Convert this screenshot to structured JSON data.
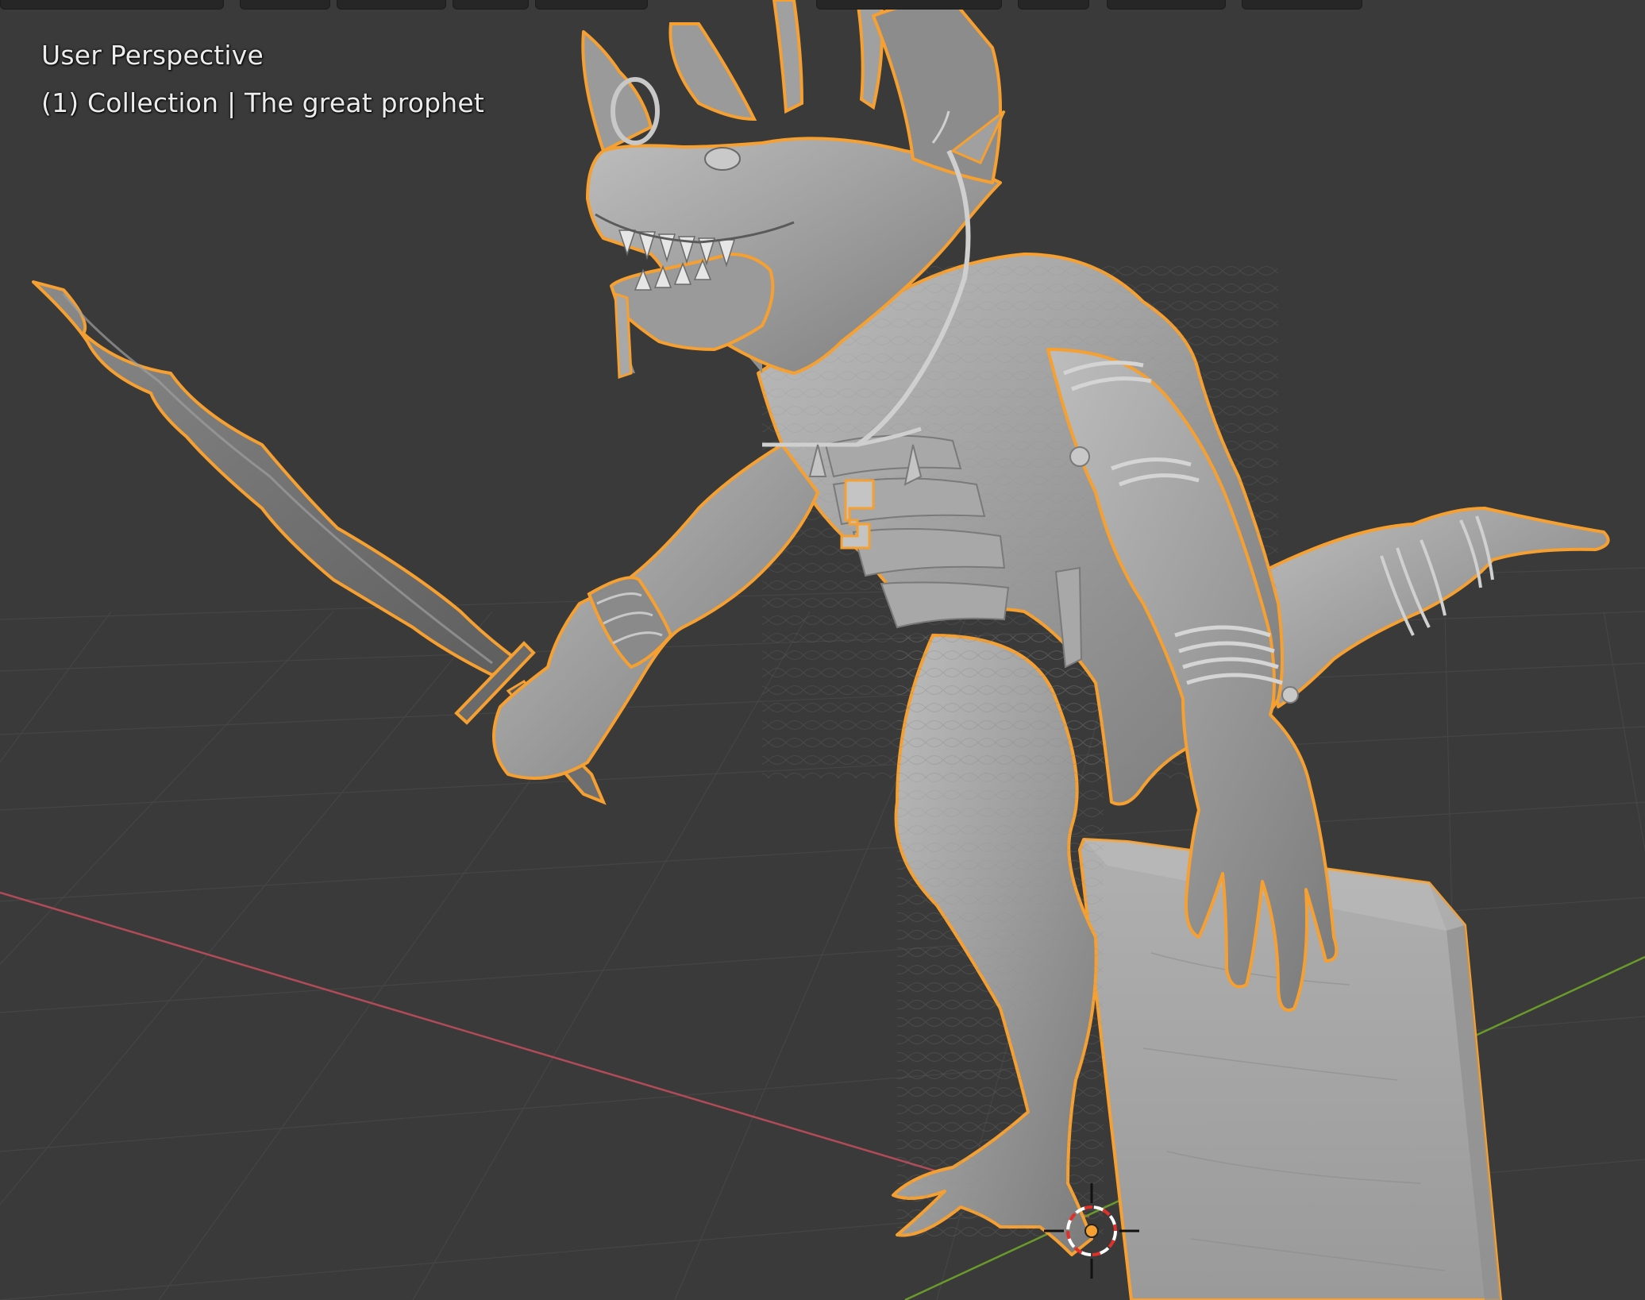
{
  "viewport": {
    "view_name": "User Perspective",
    "collection_label": "(1) Collection | The great prophet"
  },
  "colors": {
    "background": "#3a3a3a",
    "grid_line": "#444444",
    "x_axis": "#b04b57",
    "y_axis": "#6a9a2a",
    "selection_outline": "#f5a030",
    "model_base": "#9c9c9c",
    "model_light": "#c4c4c4",
    "model_dark": "#6e6e6e",
    "cursor_red": "#e0302a",
    "cursor_white": "#ffffff",
    "origin_dot": "#f5a030",
    "text": "#ececec"
  },
  "header_icons": [
    "mode-dropdown-icon",
    "view-menu-icon",
    "select-menu-icon",
    "add-menu-icon",
    "object-menu-icon",
    "transform-orientation-icon",
    "snap-icon",
    "proportional-edit-icon",
    "gizmo-icon",
    "overlay-icon"
  ],
  "scene_objects": [
    "lizard-prophet-model",
    "sword-model",
    "stone-tablet-model"
  ]
}
